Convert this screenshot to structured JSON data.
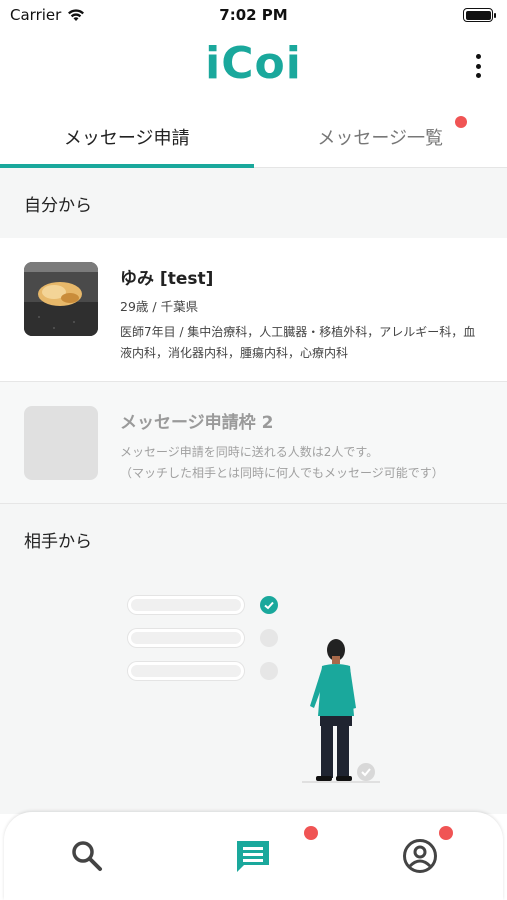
{
  "status": {
    "carrier": "Carrier",
    "time": "7:02 PM"
  },
  "header": {
    "logo": "iCoi"
  },
  "tabs": [
    {
      "label": "メッセージ申請",
      "active": true
    },
    {
      "label": "メッセージ一覧",
      "active": false,
      "badge": true
    }
  ],
  "from_me": {
    "title": "自分から",
    "cards": [
      {
        "name": "ゆみ [test]",
        "sub": "29歳 / 千葉県",
        "desc": "医師7年目 / 集中治療科，人工臓器・移植外科，アレルギー科，血液内科，消化器内科，腫瘍内科，心療内科"
      }
    ],
    "slot": {
      "title": "メッセージ申請枠 2",
      "desc_line1": "メッセージ申請を同時に送れる人数は2人です。",
      "desc_line2": "（マッチした相手とは同時に何人でもメッセージ可能です）"
    }
  },
  "from_partner": {
    "title": "相手から"
  },
  "nav": {
    "items": [
      {
        "icon": "search-icon",
        "badge": false
      },
      {
        "icon": "message-icon",
        "badge": true
      },
      {
        "icon": "profile-icon",
        "badge": true
      }
    ]
  },
  "colors": {
    "accent": "#1aa89c",
    "badge": "#f05454"
  }
}
